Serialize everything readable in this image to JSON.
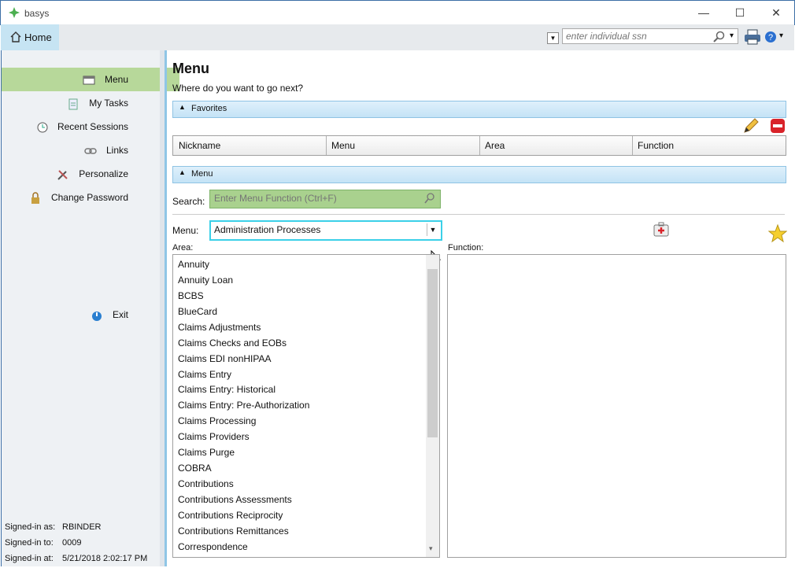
{
  "window": {
    "title": "basys",
    "minimize": "—",
    "maximize": "☐",
    "close": "✕"
  },
  "toolbar": {
    "home_tab": "Home",
    "ssn_placeholder": "enter individual ssn",
    "dropdown_glyph": "▾"
  },
  "sidebar": {
    "items": [
      {
        "label": "Menu",
        "icon": "menu-window-icon"
      },
      {
        "label": "My Tasks",
        "icon": "clipboard-icon"
      },
      {
        "label": "Recent Sessions",
        "icon": "clock-back-icon"
      },
      {
        "label": "Links",
        "icon": "chain-link-icon"
      },
      {
        "label": "Personalize",
        "icon": "tools-icon"
      },
      {
        "label": "Change Password",
        "icon": "lock-icon"
      }
    ],
    "exit_label": "Exit",
    "signed_in_as_label": "Signed-in as:",
    "signed_in_as": "RBINDER",
    "signed_in_to_label": "Signed-in to:",
    "signed_in_to": "0009",
    "signed_in_at_label": "Signed-in at:",
    "signed_in_at": "5/21/2018 2:02:17 PM"
  },
  "main": {
    "title": "Menu",
    "subtitle": "Where do you want to go next?",
    "favorites_header": "Favorites",
    "favorites_columns": [
      "Nickname",
      "Menu",
      "Area",
      "Function"
    ],
    "menu_header": "Menu",
    "search_label": "Search:",
    "search_placeholder": "Enter Menu Function (Ctrl+F)",
    "menu_label": "Menu:",
    "menu_selected": "Administration Processes",
    "area_label": "Area:",
    "function_label": "Function:",
    "areas": [
      "Annuity",
      "Annuity Loan",
      "BCBS",
      "BlueCard",
      "Claims Adjustments",
      "Claims Checks and EOBs",
      "Claims EDI nonHIPAA",
      "Claims Entry",
      "Claims Entry: Historical",
      "Claims Entry: Pre-Authorization",
      "Claims Processing",
      "Claims Providers",
      "Claims Purge",
      "COBRA",
      "Contributions",
      "Contributions Assessments",
      "Contributions Reciprocity",
      "Contributions Remittances",
      "Correspondence"
    ]
  },
  "colors": {
    "accent_green": "#b7d89a",
    "header_blue": "#c4e3f6",
    "focus_cyan": "#3bd0e8",
    "danger_red": "#d9232a"
  }
}
